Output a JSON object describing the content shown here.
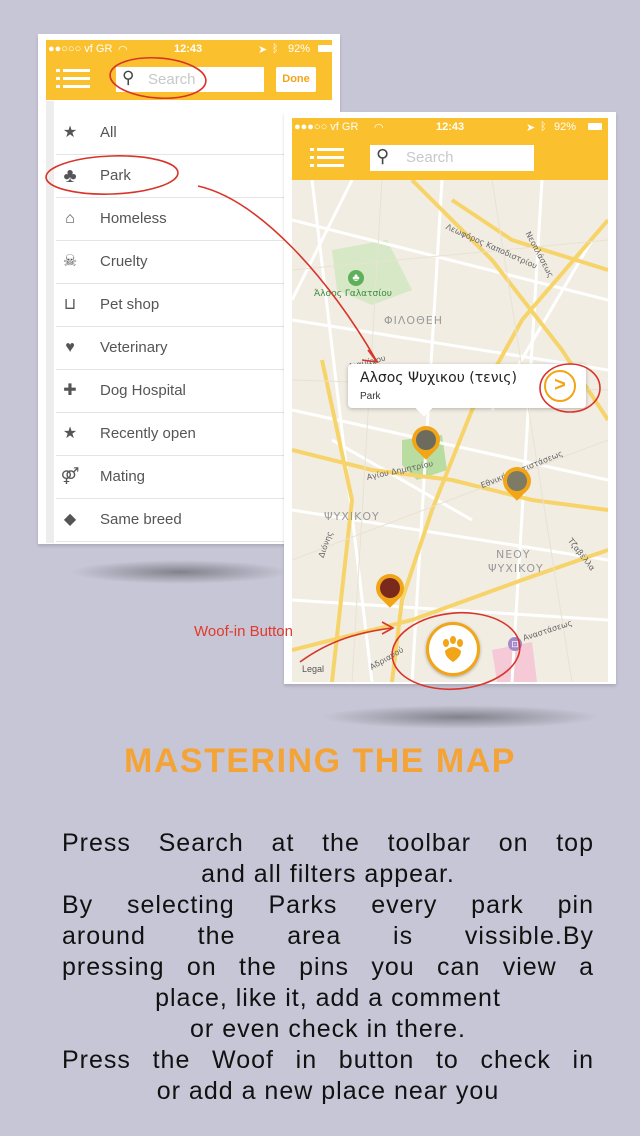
{
  "colors": {
    "background": "#c7c6d6",
    "accent": "#fbc02d",
    "title": "#f4a436",
    "annotation": "#e03a2a",
    "pin": "#f2a516"
  },
  "phone_left": {
    "status": {
      "carrier": "●●○○○ vf GR",
      "time": "12:43",
      "battery": "92%"
    },
    "toolbar": {
      "menu_icon": "hamburger-icon",
      "search_placeholder": "Search",
      "done_label": "Done"
    },
    "filters": [
      {
        "label": "All",
        "icon": "star-icon"
      },
      {
        "label": "Park",
        "icon": "tree-icon"
      },
      {
        "label": "Homeless",
        "icon": "house-icon"
      },
      {
        "label": "Cruelty",
        "icon": "skull-icon"
      },
      {
        "label": "Pet shop",
        "icon": "basket-icon"
      },
      {
        "label": "Veterinary",
        "icon": "heart-plus-icon"
      },
      {
        "label": "Dog Hospital",
        "icon": "hospital-icon"
      },
      {
        "label": "Recently open",
        "icon": "star-icon"
      },
      {
        "label": "Mating",
        "icon": "mating-icon"
      },
      {
        "label": "Same breed",
        "icon": "dog-icon"
      }
    ]
  },
  "phone_right": {
    "status": {
      "carrier": "●●●○○ vf GR",
      "time": "12:43",
      "battery": "92%"
    },
    "toolbar": {
      "menu_icon": "hamburger-icon",
      "search_placeholder": "Search"
    },
    "map": {
      "labels": {
        "park_name": "Άλσος Γαλατσίου",
        "area1": "ΦΙΛΟΘΕΗ",
        "area2": "ΨΥΧΙΚΟΥ",
        "area3": "ΝΕΟΥ",
        "area4": "ΨΥΧΙΚΟΥ",
        "street1": "Λεωφόρος Καποδιστρίου",
        "street2": "Νεοπλάσεως",
        "street3": "Αγίου Δημητρίου",
        "street4": "Εθνικής Αντιστάσεως",
        "street5": "Τζαβέλλα",
        "street6": "Αναστάσεως",
        "street7": "Αδριανού",
        "street8": "Διαμάχου",
        "street9": "Διόνης",
        "legal": "Legal"
      },
      "callout": {
        "title": "Αλσος Ψυχικου (τενις)",
        "subtitle": "Park",
        "action_icon": "chevron-right-icon"
      },
      "woof_button_icon": "paw-icon"
    }
  },
  "annotation": {
    "woof_label": "Woof-in Button"
  },
  "heading": "MASTERING THE MAP",
  "description": {
    "l1": "Press Search at the toolbar on top",
    "l2": "and all filters appear.",
    "l3": "By selecting Parks every park pin",
    "l4": "around the area is vissible.By",
    "l5": "pressing on the pins you can view a",
    "l6": "place, like it, add a comment",
    "l7": "or even check  in there.",
    "l8": "Press the Woof in button to check in",
    "l9": "or add a new place near you"
  }
}
